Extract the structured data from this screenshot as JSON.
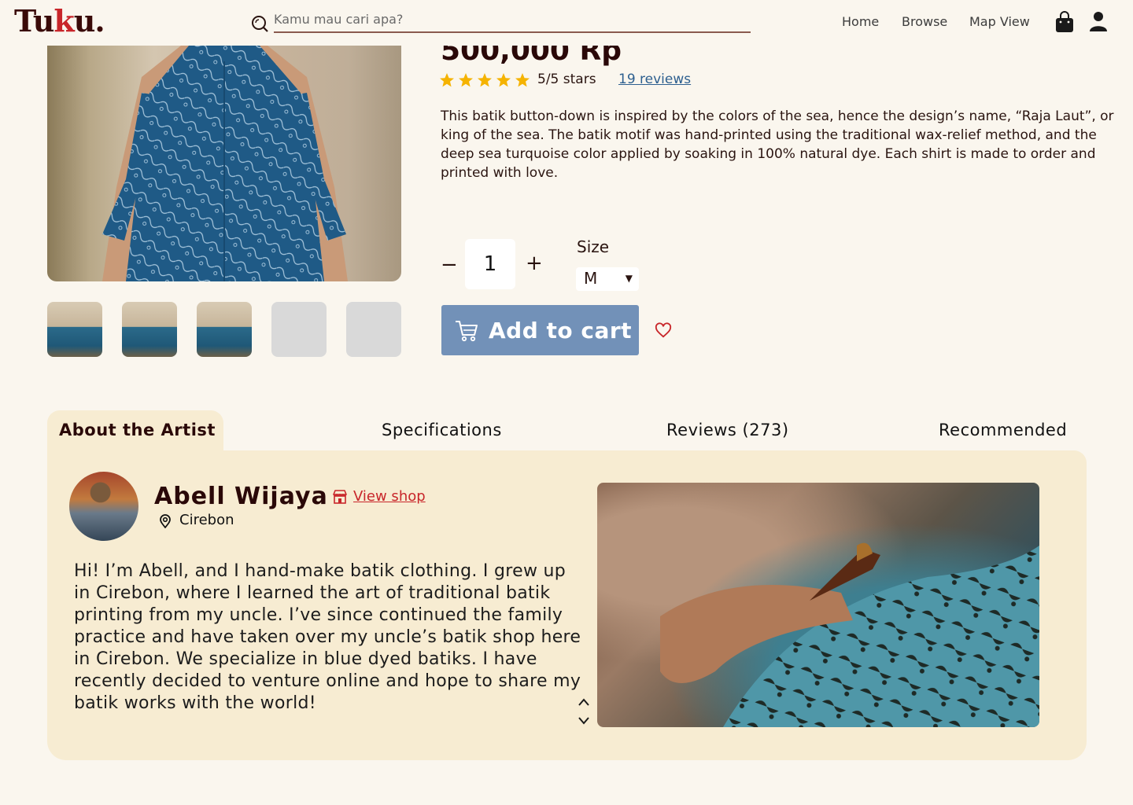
{
  "header": {
    "logo": "Tuku.",
    "logo_parts": [
      "Tu",
      "k",
      "u."
    ],
    "search_placeholder": "Kamu mau cari apa?",
    "nav": {
      "home": "Home",
      "browse": "Browse",
      "map": "Map View"
    }
  },
  "product": {
    "price": "500,000 Rp",
    "rating_stars": 5,
    "rating_text": "5/5 stars",
    "reviews_link": "19 reviews",
    "description": "This batik button-down is inspired by the colors of the sea, hence the design’s name, “Raja Laut”, or king of the sea. The batik motif was hand-printed using the traditional wax-relief method, and the deep sea turquoise color applied by soaking in 100% natural dye. Each shirt is made to order and printed with love.",
    "quantity_minus": "−",
    "quantity": "1",
    "quantity_plus": "+",
    "size_label": "Size",
    "size_value": "M",
    "add_to_cart": "Add to cart"
  },
  "tabs": {
    "about": "About the Artist",
    "specs": "Specifications",
    "reviews": "Reviews (273)",
    "recommended": "Recommended"
  },
  "artist": {
    "name": "Abell Wijaya",
    "view_shop": "View shop",
    "location": "Cirebon",
    "bio": "Hi! I’m Abell, and I hand-make batik clothing. I grew up in Cirebon, where I learned the art of traditional batik printing from my uncle. I’ve since continued the family practice and have taken over my uncle’s batik shop here in Cirebon. We specialize in blue dyed batiks. I have recently decided to venture online and hope to share my batik works with the world!"
  },
  "colors": {
    "background": "#faf6ee",
    "accent_red": "#c8262a",
    "cart_button": "#7291b8",
    "star": "#f5b301",
    "panel": "#f7ecd2"
  }
}
